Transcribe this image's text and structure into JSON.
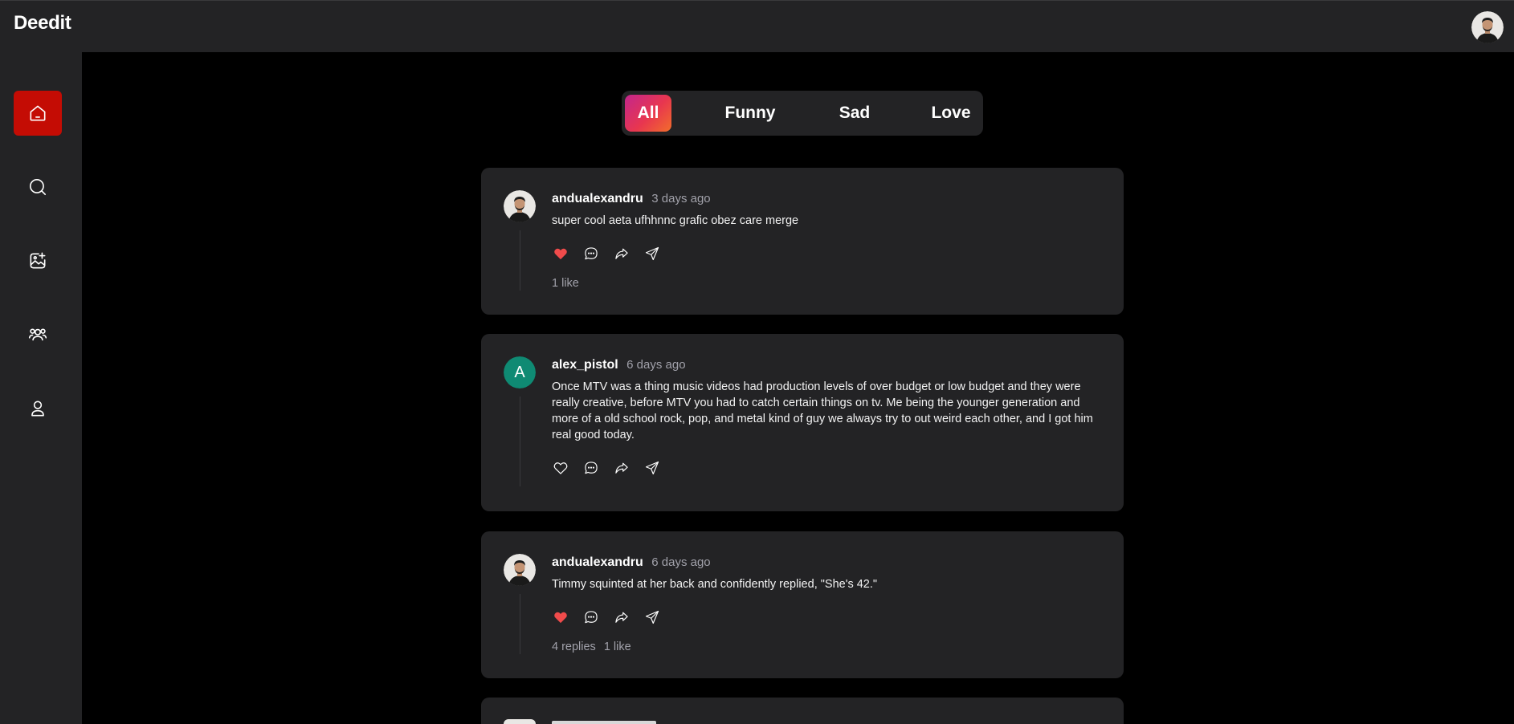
{
  "app": {
    "brand": "Deedit"
  },
  "colors": {
    "active_nav": "#c40c04",
    "panel_bg": "#232325",
    "page_bg": "#000000",
    "like_red": "#f04b4b",
    "muted_text": "#a1a1aa",
    "letter_avatar_bg": "#0f8a73"
  },
  "sidebar": {
    "items": [
      {
        "name": "home",
        "icon": "home-icon",
        "active": true
      },
      {
        "name": "search",
        "icon": "search-icon",
        "active": false
      },
      {
        "name": "add-image",
        "icon": "image-plus-icon",
        "active": false
      },
      {
        "name": "community",
        "icon": "users-icon",
        "active": false
      },
      {
        "name": "profile",
        "icon": "user-icon",
        "active": false
      }
    ]
  },
  "filters": {
    "tabs": [
      {
        "label": "All",
        "active": true
      },
      {
        "label": "Funny",
        "active": false
      },
      {
        "label": "Sad",
        "active": false
      },
      {
        "label": "Love",
        "active": false
      }
    ]
  },
  "posts": [
    {
      "username": "andualexandru",
      "time": "3 days ago",
      "text": "super cool aeta ufhhnnc grafic obez care merge",
      "liked": true,
      "replies": "",
      "likes": "1 like"
    },
    {
      "username": "alex_pistol",
      "time": "6 days ago",
      "avatar_letter": "A",
      "text": "Once MTV was a thing music videos had production levels of over budget or low budget and they were really creative, before MTV you had to catch certain things on tv. Me being the younger generation and more of a old school rock, pop, and metal kind of guy we always try to out weird each other, and I got him real good today.",
      "liked": false,
      "replies": "",
      "likes": ""
    },
    {
      "username": "andualexandru",
      "time": "6 days ago",
      "text": "Timmy squinted at her back and confidently replied, \"She's 42.\"",
      "liked": true,
      "replies": "4 replies",
      "likes": "1 like"
    }
  ]
}
